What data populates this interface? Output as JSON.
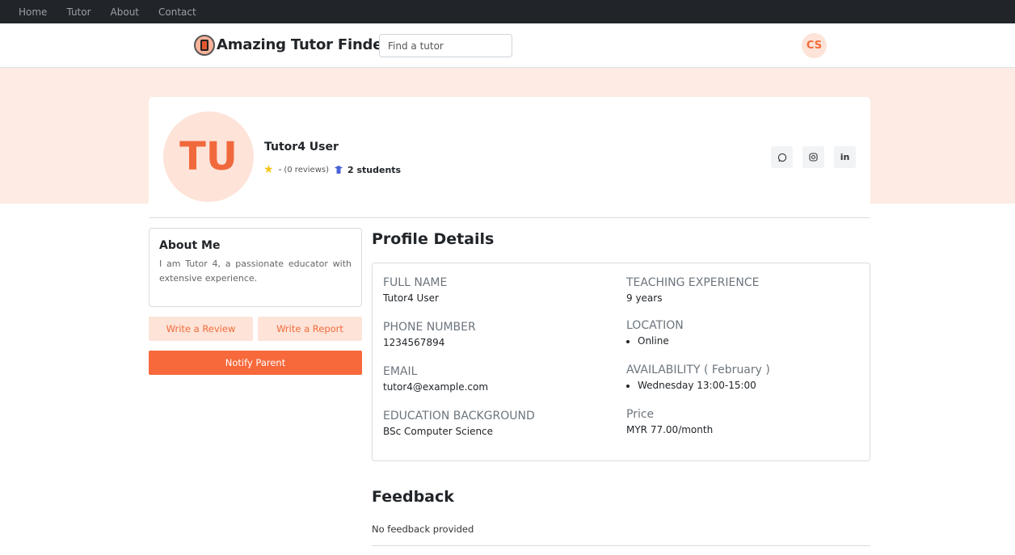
{
  "topnav": {
    "items": [
      "Home",
      "Tutor",
      "About",
      "Contact"
    ]
  },
  "header": {
    "brand": "Amazing Tutor Finder",
    "search_placeholder": "Find a tutor",
    "user_initials": "CS"
  },
  "profile": {
    "initials": "TU",
    "name": "Tutor4 User",
    "rating": "-",
    "reviews": "(0 reviews)",
    "students": "2 students",
    "social": [
      "whatsapp-icon",
      "instagram-icon",
      "linkedin-icon"
    ]
  },
  "about": {
    "title": "About Me",
    "text": "I am Tutor 4, a passionate educator with extensive experience."
  },
  "actions": {
    "write_review": "Write a Review",
    "write_report": "Write a Report",
    "notify_parent": "Notify Parent"
  },
  "details": {
    "title": "Profile Details",
    "full_name_label": "FULL NAME",
    "full_name": "Tutor4 User",
    "phone_label": "PHONE NUMBER",
    "phone": "1234567894",
    "email_label": "EMAIL",
    "email": "tutor4@example.com",
    "education_label": "EDUCATION BACKGROUND",
    "education": "BSc Computer Science",
    "experience_label": "TEACHING EXPERIENCE",
    "experience": "9 years",
    "location_label": "LOCATION",
    "location": "Online",
    "availability_label": "AVAILABILITY ( February )",
    "availability": "Wednesday 13:00-15:00",
    "price_label": "Price",
    "price": "MYR 77.00/month"
  },
  "feedback": {
    "title": "Feedback",
    "text": "No feedback provided"
  },
  "colors": {
    "accent": "#f7683a",
    "accent_light": "#fde3d8",
    "banner": "#fdebe4",
    "dark_nav": "#212529"
  }
}
